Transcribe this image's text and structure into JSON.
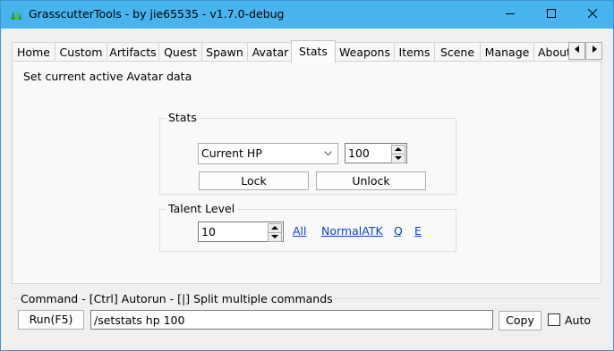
{
  "window": {
    "title": "GrasscutterTools  - by jie65535  - v1.7.0-debug"
  },
  "tabs": [
    "Home",
    "Custom",
    "Artifacts",
    "Quest",
    "Spawn",
    "Avatar",
    "Stats",
    "Weapons",
    "Items",
    "Scene",
    "Manage",
    "About"
  ],
  "active_tab": "Stats",
  "panel": {
    "description": "Set current active Avatar data",
    "stats_group": {
      "legend": "Stats",
      "stat_select_value": "Current HP",
      "stat_value": "100",
      "lock_label": "Lock",
      "unlock_label": "Unlock"
    },
    "talent_group": {
      "legend": "Talent Level",
      "level_value": "10",
      "links": [
        "All",
        "NormalATK",
        "Q",
        "E"
      ]
    }
  },
  "command": {
    "legend": "Command  - [Ctrl] Autorun  - [|] Split multiple commands",
    "run_label": "Run(F5)",
    "value": "/setstats hp 100",
    "copy_label": "Copy",
    "auto_label": "Auto",
    "auto_checked": false
  }
}
